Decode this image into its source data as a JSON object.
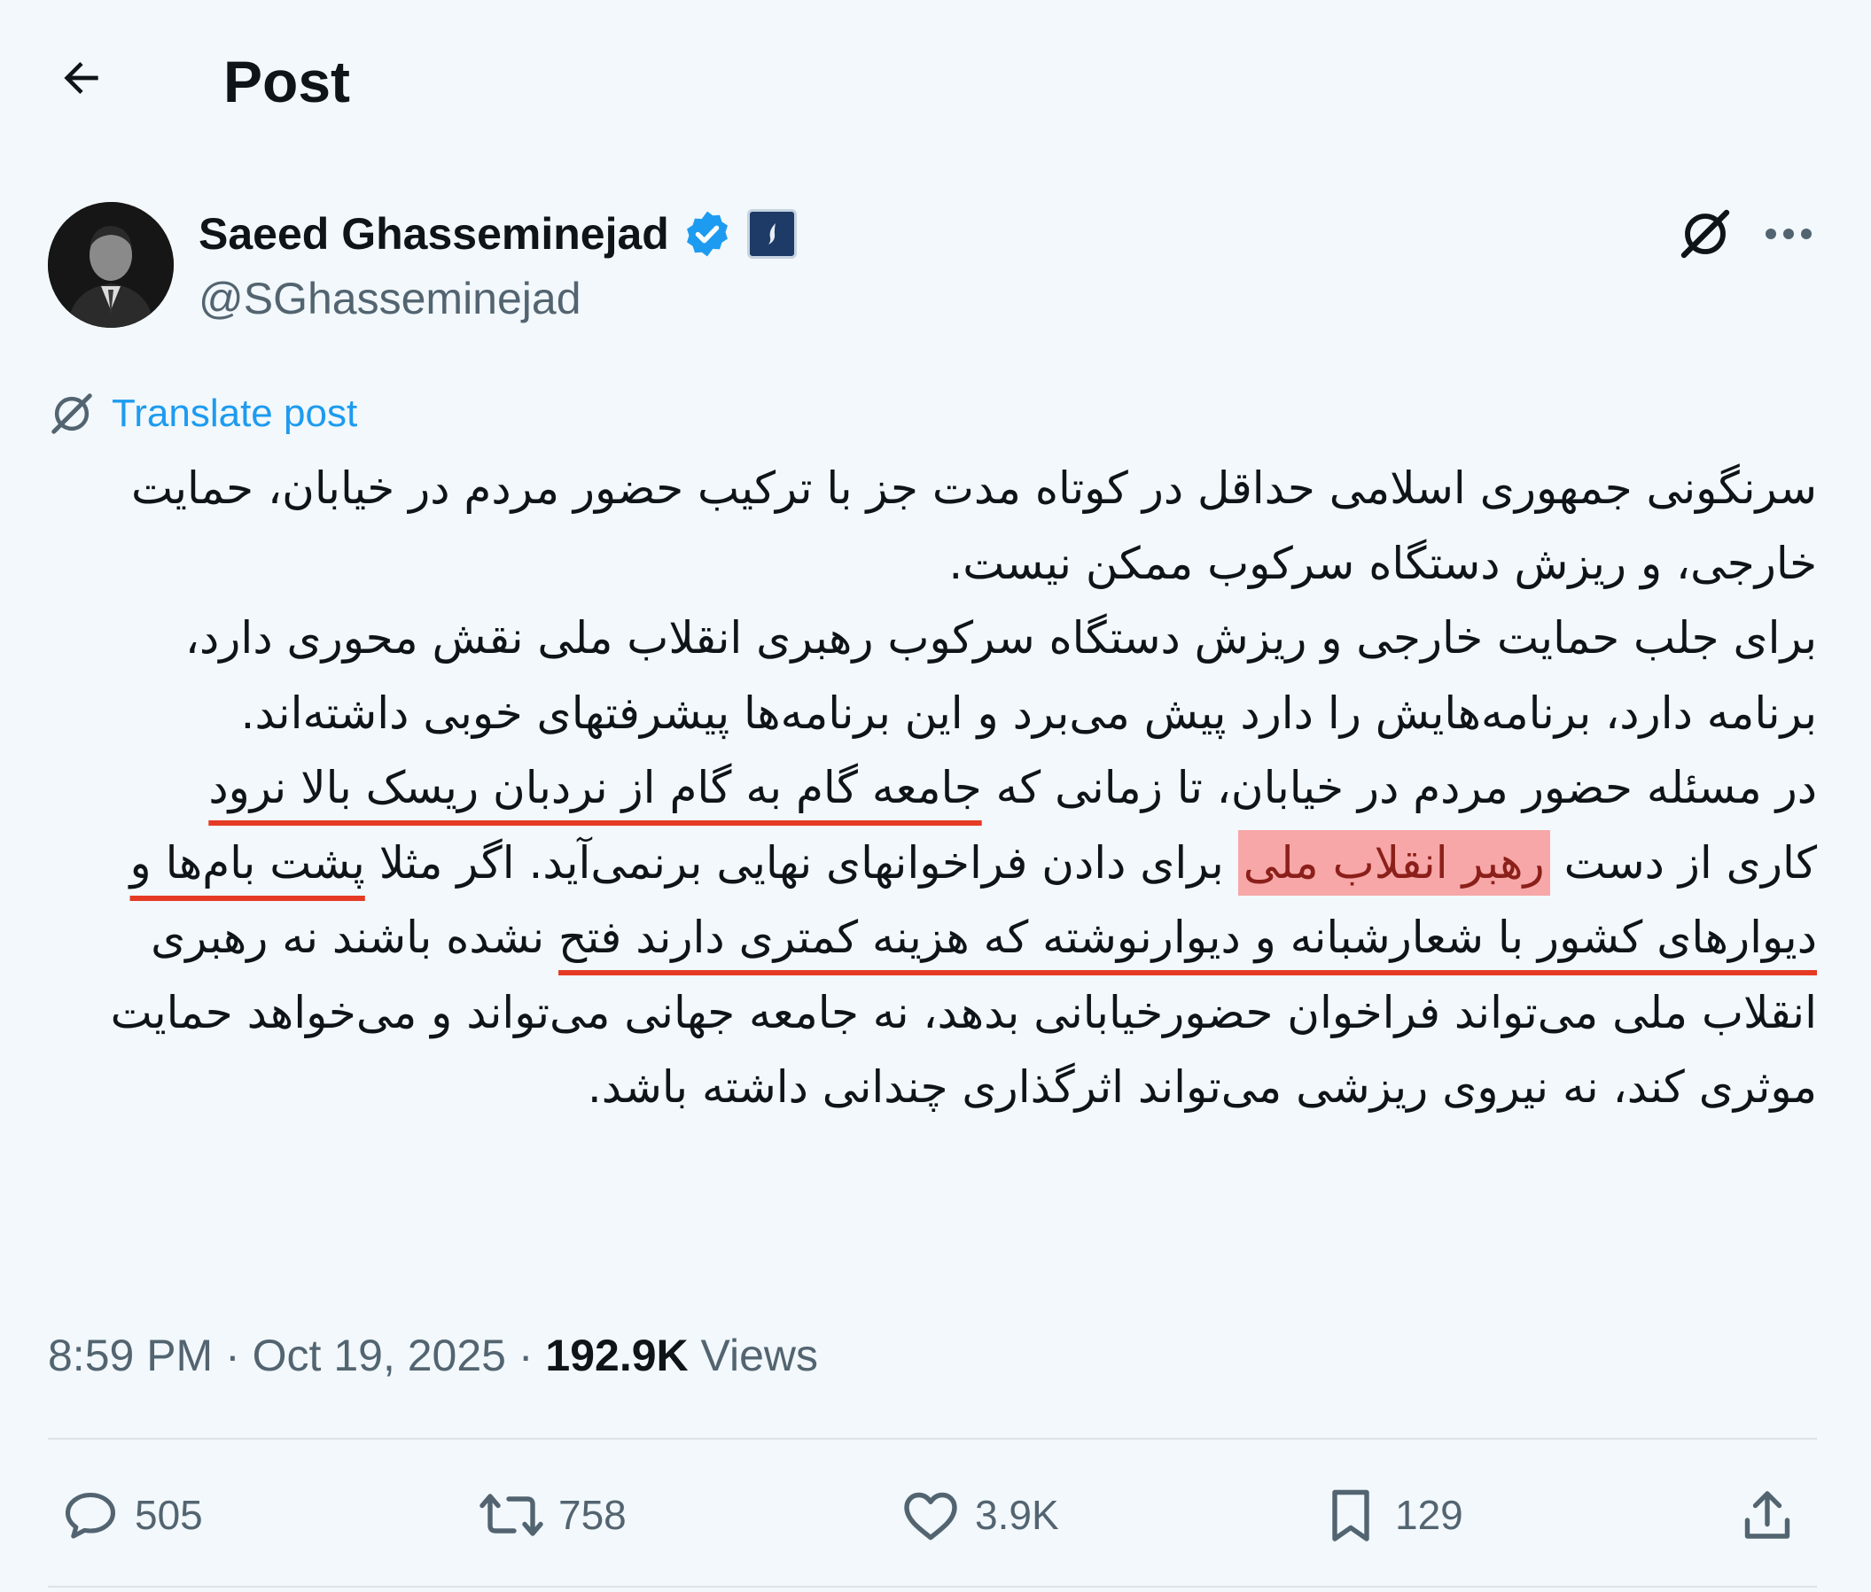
{
  "header": {
    "title": "Post"
  },
  "author": {
    "name": "Saeed Ghasseminejad",
    "handle": "@SGhasseminejad"
  },
  "translate": {
    "label": "Translate post"
  },
  "tweet": {
    "p1": "سرنگونی جمهوری اسلامی حداقل در کوتاه مدت جز با ترکیب حضور مردم در خیابان، حمایت خارجی، و ریزش دستگاه سرکوب ممکن نیست.",
    "p2": "برای جلب حمایت خارجی و ریزش دستگاه سرکوب رهبری انقلاب ملی نقش محوری دارد، برنامه دارد، برنامه‌هایش را دارد پیش می‌برد و این برنامه‌ها پیشرفتهای خوبی داشته‌اند.",
    "p3_a": "در مسئله حضور مردم در خیابان، تا زمانی که ",
    "p3_b": "جامعه گام به گام از نردبان ریسک بالا نرود",
    "p3_c": " کاری از دست ",
    "p3_d": "رهبر انقلاب ملی",
    "p3_e": " برای دادن فراخوانهای نهایی برنمی‌آید. اگر مثلا ",
    "p3_f": "پشت بام‌ها و دیوارهای کشور با شعارشبانه و دیوارنوشته که هزینه کمتری دارند فتح",
    "p3_g": " نشده باشند نه رهبری انقلاب ملی می‌تواند فراخوان حضورخیابانی بدهد، نه جامعه جهانی می‌تواند و می‌خواهد حمایت موثری کند، نه نیروی ریزشی می‌تواند اثرگذاری چندانی داشته باشد."
  },
  "meta": {
    "time": "8:59 PM",
    "date": "Oct 19, 2025",
    "separator": " · ",
    "views_count": "192.9K",
    "views_label": "Views"
  },
  "actions": {
    "replies": "505",
    "reposts": "758",
    "likes": "3.9K",
    "bookmarks": "129"
  },
  "colors": {
    "accent": "#1d9bf0",
    "underline": "#e53b24",
    "highlight": "#f7a7a7",
    "background": "#f2f8fb"
  },
  "icons": [
    "back-arrow-icon",
    "verified-badge-icon",
    "affiliate-badge-icon",
    "grok-icon",
    "more-icon",
    "translate-icon",
    "reply-icon",
    "repost-icon",
    "like-icon",
    "bookmark-icon",
    "share-icon"
  ]
}
